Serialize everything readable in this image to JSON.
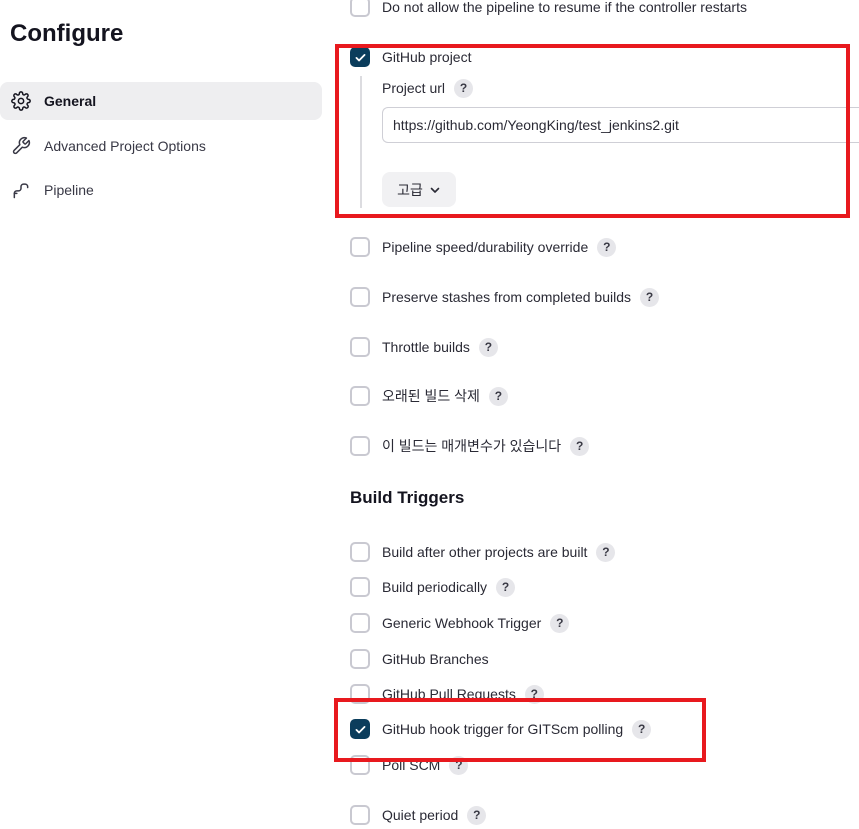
{
  "page_title": "Configure",
  "sidebar": {
    "items": [
      {
        "label": "General",
        "icon": "gear-icon",
        "active": true
      },
      {
        "label": "Advanced Project Options",
        "icon": "wrench-icon",
        "active": false
      },
      {
        "label": "Pipeline",
        "icon": "pipeline-icon",
        "active": false
      }
    ]
  },
  "general": {
    "resume_option": {
      "label": "Do not allow the pipeline to resume if the controller restarts",
      "checked": false
    },
    "github_project": {
      "label": "GitHub project",
      "checked": true,
      "project_url_label": "Project url",
      "project_url_value": "https://github.com/YeongKing/test_jenkins2.git",
      "advanced_label": "고급"
    },
    "options": [
      {
        "label": "Pipeline speed/durability override",
        "checked": false
      },
      {
        "label": "Preserve stashes from completed builds",
        "checked": false
      },
      {
        "label": "Throttle builds",
        "checked": false
      },
      {
        "label": "오래된 빌드 삭제",
        "checked": false
      },
      {
        "label": "이 빌드는 매개변수가 있습니다",
        "checked": false
      }
    ]
  },
  "build_triggers": {
    "heading": "Build Triggers",
    "items": [
      {
        "label": "Build after other projects are built",
        "checked": false
      },
      {
        "label": "Build periodically",
        "checked": false
      },
      {
        "label": "Generic Webhook Trigger",
        "checked": false
      },
      {
        "label": "GitHub Branches",
        "checked": false
      },
      {
        "label": "GitHub Pull Requests",
        "checked": false
      },
      {
        "label": "GitHub hook trigger for GITScm polling",
        "checked": true
      },
      {
        "label": "Poll SCM",
        "checked": false
      },
      {
        "label": "Quiet period",
        "checked": false
      }
    ]
  },
  "help_symbol": "?",
  "colors": {
    "checkbox_checked": "#0b3d5c",
    "annotation_border": "#e8191e",
    "active_nav_bg": "#eeeef0"
  }
}
